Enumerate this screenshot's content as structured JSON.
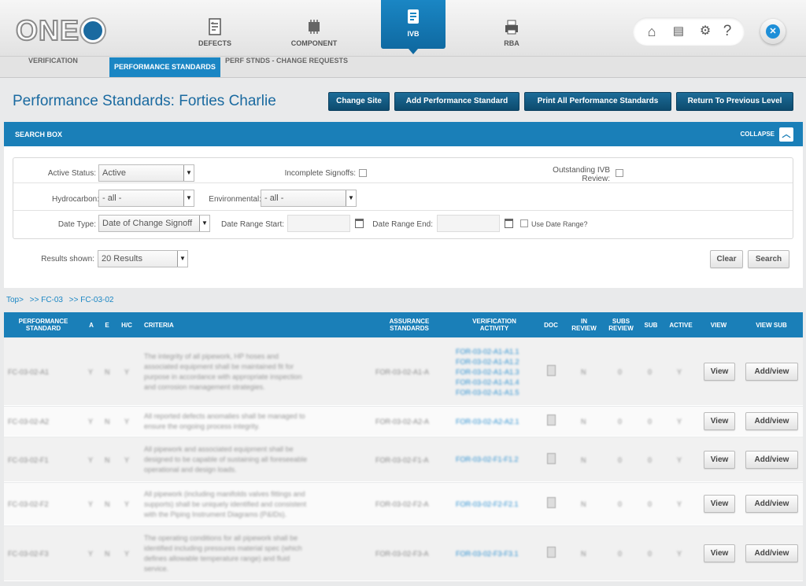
{
  "header": {
    "logo": "ONE",
    "nav": [
      {
        "label": "DEFECTS",
        "icon": "defects-list-icon"
      },
      {
        "label": "COMPONENT",
        "icon": "component-chip-icon"
      },
      {
        "label": "IVB",
        "icon": "ivb-clipboard-icon",
        "active": true
      },
      {
        "label": "RBA",
        "icon": "rba-printer-icon"
      }
    ],
    "tools": [
      "home-icon",
      "settings-doc-icon",
      "gears-icon",
      "help-icon"
    ],
    "close_label": "✕"
  },
  "subnav": {
    "tabs": [
      {
        "label": "VERIFICATION"
      },
      {
        "label": "PERFORMANCE STANDARDS",
        "active": true
      },
      {
        "label": "PERF STNDS - CHANGE REQUESTS"
      }
    ]
  },
  "page": {
    "title": "Performance Standards: Forties Charlie",
    "buttons": [
      "Change Site",
      "Add Performance Standard",
      "Print All Performance Standards",
      "Return To Previous Level"
    ]
  },
  "search": {
    "title": "SEARCH BOX",
    "collapse_label": "COLLAPSE",
    "active_status_label": "Active Status:",
    "active_status_value": "Active",
    "incomplete_signoffs_label": "Incomplete Signoffs:",
    "outstanding_ivb_label_1": "Outstanding IVB",
    "outstanding_ivb_label_2": "Review:",
    "hydrocarbon_label": "Hydrocarbon:",
    "hydrocarbon_value": "- all -",
    "environmental_label": "Environmental:",
    "environmental_value": "- all -",
    "date_type_label": "Date Type:",
    "date_type_value": "Date of Change Signoff",
    "date_start_label": "Date Range Start:",
    "date_end_label": "Date Range End:",
    "use_date_range_label": "Use Date Range?",
    "results_label": "Results shown:",
    "results_value": "20 Results",
    "clear_label": "Clear",
    "search_label": "Search"
  },
  "breadcrumb": [
    "Top>",
    ">> FC-03",
    ">> FC-03-02"
  ],
  "table": {
    "headers": {
      "ps": "PERFORMANCE STANDARD",
      "a": "A",
      "e": "E",
      "hc": "H/C",
      "criteria": "CRITERIA",
      "assurance": "ASSURANCE STANDARDS",
      "verification": "VERIFICATION ACTIVITY",
      "doc": "DOC",
      "in_review": "IN REVIEW",
      "subs_review": "SUBS REVIEW",
      "sub": "SUB",
      "active": "ACTIVE",
      "view": "VIEW",
      "view_sub": "VIEW SUB"
    },
    "view_label": "View",
    "addview_label": "Add/view",
    "rows": [
      {
        "ps": "FC-03-02-A1",
        "a": "Y",
        "e": "N",
        "hc": "Y",
        "criteria": [
          "The integrity of all pipework, HP hoses and",
          "associated equipment shall be maintained fit for",
          "purpose in accordance with appropriate inspection",
          "and corrosion management strategies."
        ],
        "assurance": "FOR-03-02-A1-A",
        "verification": [
          "FOR-03-02-A1-A1.1",
          "FOR-03-02-A1-A1.2",
          "FOR-03-02-A1-A1.3",
          "FOR-03-02-A1-A1.4",
          "FOR-03-02-A1-A1.5"
        ],
        "in_review": "N",
        "subs_review": "0",
        "sub": "0",
        "active": "Y"
      },
      {
        "ps": "FC-03-02-A2",
        "a": "Y",
        "e": "N",
        "hc": "Y",
        "criteria": [
          "All reported defects anomalies shall be managed to",
          "ensure the ongoing process integrity."
        ],
        "assurance": "FOR-03-02-A2-A",
        "verification": [
          "FOR-03-02-A2-A2.1"
        ],
        "in_review": "N",
        "subs_review": "0",
        "sub": "0",
        "active": "Y"
      },
      {
        "ps": "FC-03-02-F1",
        "a": "Y",
        "e": "N",
        "hc": "Y",
        "criteria": [
          "All pipework and associated equipment shall be",
          "designed to be capable of sustaining all foreseeable",
          "operational and design loads."
        ],
        "assurance": "FOR-03-02-F1-A",
        "verification": [
          "FOR-03-02-F1-F1.2"
        ],
        "in_review": "N",
        "subs_review": "0",
        "sub": "0",
        "active": "Y"
      },
      {
        "ps": "FC-03-02-F2",
        "a": "Y",
        "e": "N",
        "hc": "Y",
        "criteria": [
          "All pipework (including manifolds valves fittings and",
          "supports) shall be uniquely identified and consistent",
          "with the Piping Instrument Diagrams (P&IDs)."
        ],
        "assurance": "FOR-03-02-F2-A",
        "verification": [
          "FOR-03-02-F2-F2.1"
        ],
        "in_review": "N",
        "subs_review": "0",
        "sub": "0",
        "active": "Y"
      },
      {
        "ps": "FC-03-02-F3",
        "a": "Y",
        "e": "N",
        "hc": "Y",
        "criteria": [
          "The operating conditions for all pipework shall be",
          "identified including pressures material spec (which",
          "defines allowable temperature range) and fluid",
          "service."
        ],
        "assurance": "FOR-03-02-F3-A",
        "verification": [
          "FOR-03-02-F3-F3.1"
        ],
        "in_review": "N",
        "subs_review": "0",
        "sub": "0",
        "active": "Y"
      }
    ]
  }
}
